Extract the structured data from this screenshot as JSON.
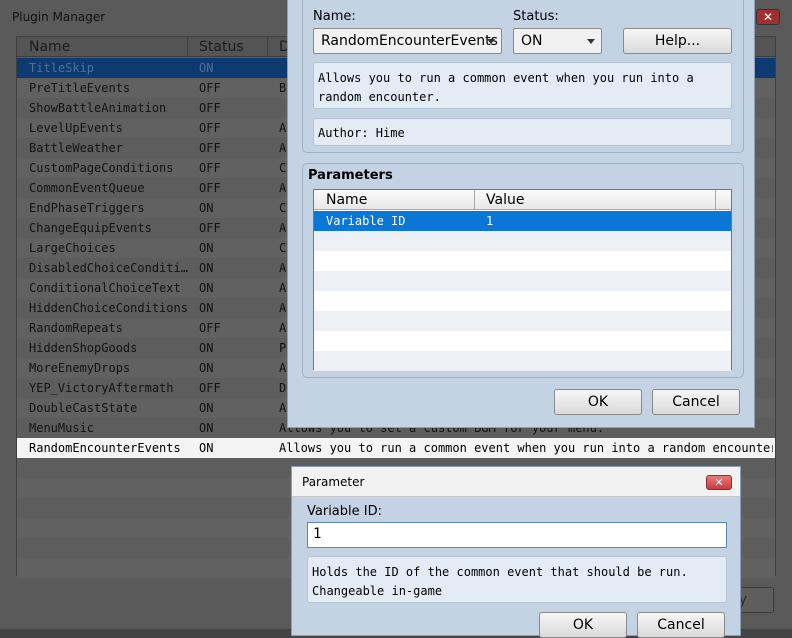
{
  "plugin_manager": {
    "title": "Plugin Manager",
    "close_glyph": "✕",
    "columns": {
      "name": "Name",
      "status": "Status",
      "description": "D"
    },
    "rows": [
      {
        "name": "TitleSkip",
        "status": "ON",
        "desc": "",
        "state": "selected"
      },
      {
        "name": "PreTitleEvents",
        "status": "OFF",
        "desc": "B",
        "state": ""
      },
      {
        "name": "ShowBattleAnimation",
        "status": "OFF",
        "desc": "",
        "state": ""
      },
      {
        "name": "LevelUpEvents",
        "status": "OFF",
        "desc": "A",
        "state": ""
      },
      {
        "name": "BattleWeather",
        "status": "OFF",
        "desc": "A",
        "state": ""
      },
      {
        "name": "CustomPageConditions",
        "status": "OFF",
        "desc": "C",
        "state": ""
      },
      {
        "name": "CommonEventQueue",
        "status": "OFF",
        "desc": "A",
        "state": ""
      },
      {
        "name": "EndPhaseTriggers",
        "status": "ON",
        "desc": "C",
        "state": ""
      },
      {
        "name": "ChangeEquipEvents",
        "status": "OFF",
        "desc": "A",
        "state": ""
      },
      {
        "name": "LargeChoices",
        "status": "ON",
        "desc": "C",
        "state": ""
      },
      {
        "name": "DisabledChoiceConditi…",
        "status": "ON",
        "desc": "A",
        "state": ""
      },
      {
        "name": "ConditionalChoiceText",
        "status": "ON",
        "desc": "A",
        "state": ""
      },
      {
        "name": "HiddenChoiceConditions",
        "status": "ON",
        "desc": "A",
        "state": ""
      },
      {
        "name": "RandomRepeats",
        "status": "OFF",
        "desc": "A",
        "state": ""
      },
      {
        "name": "HiddenShopGoods",
        "status": "ON",
        "desc": "P",
        "state": ""
      },
      {
        "name": "MoreEnemyDrops",
        "status": "ON",
        "desc": "A",
        "state": ""
      },
      {
        "name": "YEP_VictoryAftermath",
        "status": "OFF",
        "desc": "D",
        "state": ""
      },
      {
        "name": "DoubleCastState",
        "status": "ON",
        "desc": "A",
        "state": ""
      },
      {
        "name": "MenuMusic",
        "status": "ON",
        "desc": "Allows you to set a custom BGM for your menu.",
        "state": ""
      },
      {
        "name": "RandomEncounterEvents",
        "status": "ON",
        "desc": "Allows you to run a common event when you run into a random encounter.",
        "state": "highlighted"
      }
    ],
    "apply_label": "Apply"
  },
  "plugin_settings": {
    "name_label": "Name:",
    "name_value": "RandomEncounterEvents",
    "status_label": "Status:",
    "status_value": "ON",
    "help_label": "Help...",
    "description": "Allows you to run a common event when you run into a random encounter.",
    "author": "Author: Hime",
    "parameters_label": "Parameters",
    "param_columns": {
      "name": "Name",
      "value": "Value"
    },
    "params": [
      {
        "name": "Variable ID",
        "value": "1"
      }
    ],
    "ok_label": "OK",
    "cancel_label": "Cancel"
  },
  "parameter_dialog": {
    "title": "Parameter",
    "close_glyph": "✕",
    "field_label": "Variable ID:",
    "field_value": "1",
    "help_text": "Holds the ID of the common event that should be run.\nChangeable in-game",
    "ok_label": "OK",
    "cancel_label": "Cancel"
  }
}
